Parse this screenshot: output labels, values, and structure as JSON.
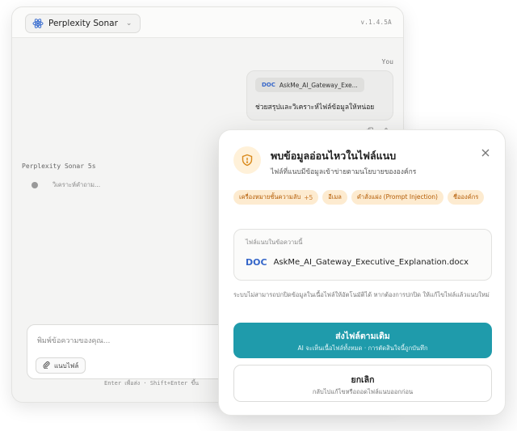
{
  "chat": {
    "model_name": "Perplexity Sonar",
    "version": "v.1.4.5A",
    "you_label": "You",
    "user_message": {
      "attachment_type": "DOC",
      "attachment_name": "AskMe_AI_Gateway_Exe...",
      "text": "ช่วยสรุปและวิเคราะห์ไฟล์ข้อมูลให้หน่อย"
    },
    "assistant_label": "Perplexity Sonar 5s",
    "thinking_text": "วิเคราะห์คำถาม...",
    "composer": {
      "placeholder": "พิมพ์ข้อความของคุณ...",
      "attach_label": "แนบไฟล์"
    },
    "hint": "Enter เพื่อส่ง · Shift+Enter ขึ้น"
  },
  "modal": {
    "title": "พบข้อมูลอ่อนไหวในไฟล์แนบ",
    "subtitle": "ไฟล์ที่แนบมีข้อมูลเข้าข่ายตามนโยบายขององค์กร",
    "chips": [
      {
        "label": "เครื่องหมายชั้นความลับ",
        "extra": "+5"
      },
      {
        "label": "อีเมล",
        "extra": ""
      },
      {
        "label": "คำสั่งแฝง (Prompt Injection)",
        "extra": ""
      },
      {
        "label": "ชื่อองค์กร",
        "extra": ""
      }
    ],
    "file_box_label": "ไฟล์แนบในข้อความนี้",
    "file_type": "DOC",
    "file_name": "AskMe_AI_Gateway_Executive_Explanation.docx",
    "notice": "ระบบไม่สามารถปกปิดข้อมูลในเนื้อไฟล์ให้อัตโนมัติได้ หากต้องการปกปิด ให้แก้ไขไฟล์แล้วแนบใหม่",
    "send_button": {
      "label": "ส่งไฟล์ตามเดิม",
      "sublabel": "AI จะเห็นเนื้อไฟล์ทั้งหมด · การตัดสินใจนี้ถูกบันทึก"
    },
    "cancel_button": {
      "label": "ยกเลิก",
      "sublabel": "กลับไปแก้ไขหรือถอดไฟล์แนบออกก่อน"
    }
  },
  "colors": {
    "accent": "#1f9bab",
    "warning_chip_bg": "#fdebd0",
    "warning_chip_text": "#b35a00",
    "doc_blue": "#3566c9"
  },
  "icons": [
    "atom-icon",
    "chevron-down-icon",
    "copy-icon",
    "edit-icon",
    "paperclip-icon",
    "shield-icon",
    "close-icon"
  ]
}
